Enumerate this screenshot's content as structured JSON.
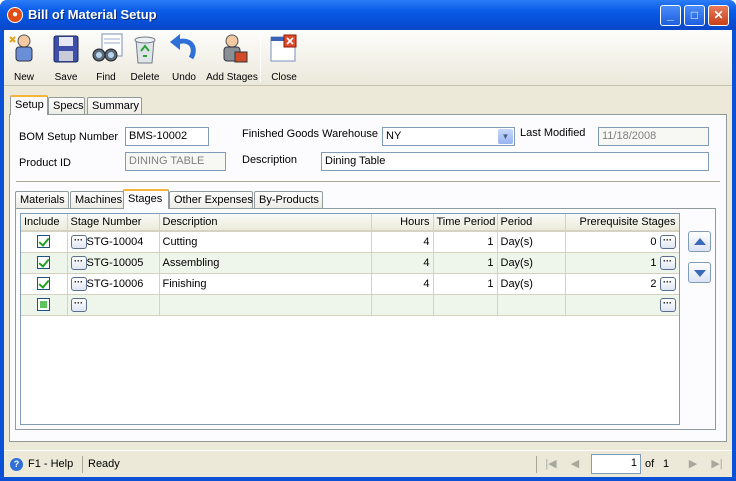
{
  "window": {
    "title": "Bill of Material Setup"
  },
  "toolbar": {
    "new": "New",
    "save": "Save",
    "find": "Find",
    "delete": "Delete",
    "undo": "Undo",
    "add_stages": "Add Stages",
    "close": "Close"
  },
  "main_tabs": [
    "Setup",
    "Specs",
    "Summary"
  ],
  "form": {
    "bom_setup_number_label": "BOM Setup Number",
    "bom_setup_number": "BMS-10002",
    "fg_warehouse_label": "Finished Goods Warehouse",
    "fg_warehouse": "NY",
    "last_modified_label": "Last Modified",
    "last_modified": "11/18/2008",
    "product_id_label": "Product ID",
    "product_id": "DINING TABLE",
    "description_label": "Description",
    "description": "Dining Table"
  },
  "sub_tabs": [
    "Materials",
    "Machines",
    "Stages",
    "Other Expenses",
    "By-Products"
  ],
  "grid": {
    "headers": [
      "Include",
      "Stage Number",
      "Description",
      "Hours",
      "Time Period",
      "Period",
      "Prerequisite Stages"
    ],
    "rows": [
      {
        "stage": "STG-10004",
        "desc": "Cutting",
        "hours": "4",
        "time": "1",
        "period": "Day(s)",
        "prereq": "0"
      },
      {
        "stage": "STG-10005",
        "desc": "Assembling",
        "hours": "4",
        "time": "1",
        "period": "Day(s)",
        "prereq": "1"
      },
      {
        "stage": "STG-10006",
        "desc": "Finishing",
        "hours": "4",
        "time": "1",
        "period": "Day(s)",
        "prereq": "2"
      }
    ],
    "ellipsis": "···"
  },
  "status": {
    "help": "F1 - Help",
    "state": "Ready",
    "page": "1",
    "of": "of",
    "total": "1"
  }
}
